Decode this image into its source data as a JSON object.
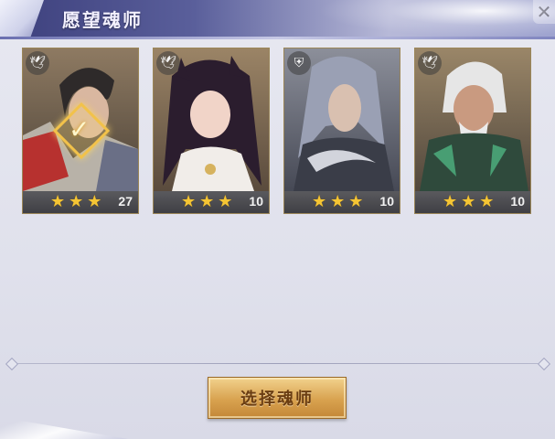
{
  "header": {
    "title": "愿望魂师",
    "close_symbol": "✕"
  },
  "cards": [
    {
      "name": "portrait-1",
      "level": "27",
      "stars": 3,
      "selected": true,
      "badge_icon": "bird-icon",
      "colors": {
        "bg": "#6b5a4a",
        "cloak": "#c63d3d"
      }
    },
    {
      "name": "portrait-2",
      "level": "10",
      "stars": 3,
      "selected": false,
      "badge_icon": "bird-icon",
      "colors": {
        "bg": "#7b6a56",
        "hair": "#2b1d2e"
      }
    },
    {
      "name": "portrait-3",
      "level": "10",
      "stars": 3,
      "selected": false,
      "badge_icon": "shield-icon",
      "colors": {
        "bg": "#6e7380",
        "hair": "#8a8fa0"
      }
    },
    {
      "name": "portrait-4",
      "level": "10",
      "stars": 3,
      "selected": false,
      "badge_icon": "bird-icon",
      "colors": {
        "bg": "#7a6a54",
        "armor": "#2f4a3c"
      }
    }
  ],
  "select_button": {
    "label": "选择魂师"
  },
  "colors": {
    "star": "#f5c534",
    "button": "#d8a24f",
    "header": "#5a5f9b"
  }
}
